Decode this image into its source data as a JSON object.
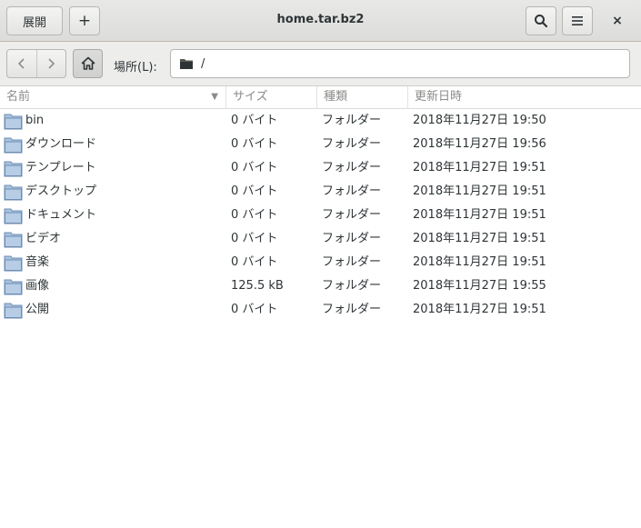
{
  "window": {
    "title": "home.tar.bz2",
    "extract_label": "展開",
    "add_label": "+",
    "close_label": "×"
  },
  "location": {
    "label": "場所(L):",
    "path": "/"
  },
  "columns": {
    "name": "名前",
    "size": "サイズ",
    "type": "種類",
    "modified": "更新日時"
  },
  "files": [
    {
      "name": "bin",
      "size": "0 バイト",
      "type": "フォルダー",
      "modified": "2018年11月27日 19:50"
    },
    {
      "name": "ダウンロード",
      "size": "0 バイト",
      "type": "フォルダー",
      "modified": "2018年11月27日 19:56"
    },
    {
      "name": "テンプレート",
      "size": "0 バイト",
      "type": "フォルダー",
      "modified": "2018年11月27日 19:51"
    },
    {
      "name": "デスクトップ",
      "size": "0 バイト",
      "type": "フォルダー",
      "modified": "2018年11月27日 19:51"
    },
    {
      "name": "ドキュメント",
      "size": "0 バイト",
      "type": "フォルダー",
      "modified": "2018年11月27日 19:51"
    },
    {
      "name": "ビデオ",
      "size": "0 バイト",
      "type": "フォルダー",
      "modified": "2018年11月27日 19:51"
    },
    {
      "name": "音楽",
      "size": "0 バイト",
      "type": "フォルダー",
      "modified": "2018年11月27日 19:51"
    },
    {
      "name": "画像",
      "size": "125.5 kB",
      "type": "フォルダー",
      "modified": "2018年11月27日 19:55"
    },
    {
      "name": "公開",
      "size": "0 バイト",
      "type": "フォルダー",
      "modified": "2018年11月27日 19:51"
    }
  ],
  "icons": {
    "row_icon": "folder-icon",
    "location_icon": "folder-icon",
    "home": "home-icon",
    "search": "search-icon",
    "menu": "menu-icon",
    "back": "chevron-left-icon",
    "forward": "chevron-right-icon"
  },
  "colors": {
    "folder_fill": "#a9c3df",
    "folder_stroke": "#6d8db3"
  }
}
